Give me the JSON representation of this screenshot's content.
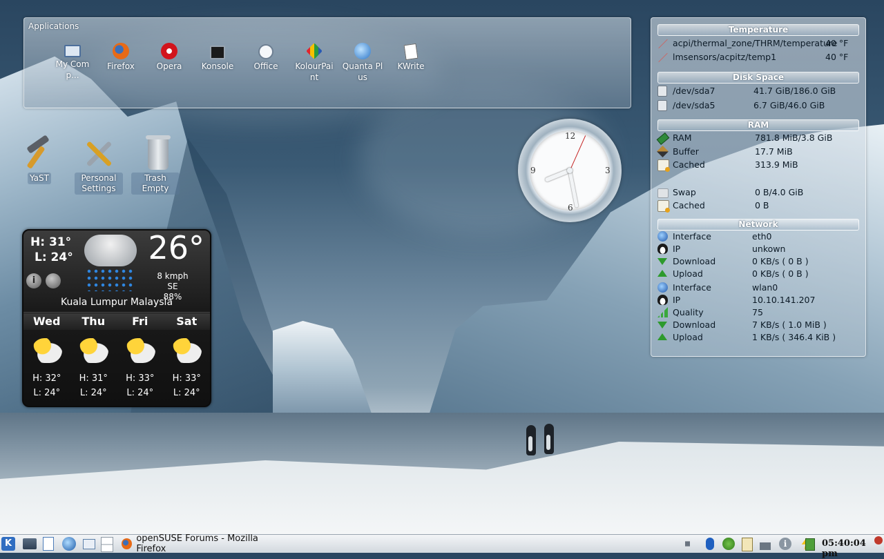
{
  "applications_panel": {
    "title": "Applications",
    "items": [
      {
        "label": "My Comp...",
        "icon": "computer-icon"
      },
      {
        "label": "Firefox",
        "icon": "firefox-icon"
      },
      {
        "label": "Opera",
        "icon": "opera-icon"
      },
      {
        "label": "Konsole",
        "icon": "terminal-icon"
      },
      {
        "label": "Office",
        "icon": "office-icon"
      },
      {
        "label": "KolourPaint",
        "icon": "paint-icon"
      },
      {
        "label": "Quanta Plus",
        "icon": "quanta-icon"
      },
      {
        "label": "KWrite",
        "icon": "editor-icon"
      }
    ]
  },
  "desktop_icons": [
    {
      "label": "YaST",
      "icon": "hammer-icon"
    },
    {
      "label": "Personal Settings",
      "icon": "tools-icon"
    },
    {
      "label": "Trash Empty",
      "icon": "trash-icon"
    }
  ],
  "weather": {
    "high": "H: 31°",
    "low": "L: 24°",
    "temperature": "26°",
    "wind": "8 kmph SE",
    "humidity": "88%",
    "location": "Kuala Lumpur Malaysia",
    "info_button": "i",
    "forecast": [
      {
        "day": "Wed",
        "high": "H: 32°",
        "low": "L: 24°"
      },
      {
        "day": "Thu",
        "high": "H: 31°",
        "low": "L: 24°"
      },
      {
        "day": "Fri",
        "high": "H: 33°",
        "low": "L: 24°"
      },
      {
        "day": "Sat",
        "high": "H: 33°",
        "low": "L: 24°"
      }
    ]
  },
  "clock": {
    "numerals": {
      "twelve": "12",
      "three": "3",
      "six": "6",
      "nine": "9"
    }
  },
  "system_monitor": {
    "temperature": {
      "header": "Temperature",
      "rows": [
        {
          "label": "acpi/thermal_zone/THRM/temperature",
          "value": "40 °F"
        },
        {
          "label": "lmsensors/acpitz/temp1",
          "value": "40 °F"
        }
      ]
    },
    "disk": {
      "header": "Disk Space",
      "rows": [
        {
          "label": "/dev/sda7",
          "value": "41.7 GiB/186.0 GiB"
        },
        {
          "label": "/dev/sda5",
          "value": "6.7 GiB/46.0 GiB"
        }
      ]
    },
    "ram": {
      "header": "RAM",
      "rows": [
        {
          "label": "RAM",
          "value": "781.8 MiB/3.8 GiB"
        },
        {
          "label": "Buffer",
          "value": "17.7 MiB"
        },
        {
          "label": "Cached",
          "value": "313.9 MiB"
        },
        {
          "label": "Swap",
          "value": "0 B/4.0 GiB"
        },
        {
          "label": "Cached",
          "value": "0 B"
        }
      ]
    },
    "network": {
      "header": "Network",
      "rows": [
        {
          "label": "Interface",
          "value": "eth0"
        },
        {
          "label": "IP",
          "value": "unkown"
        },
        {
          "label": "Download",
          "value": "0 KB/s ( 0 B )"
        },
        {
          "label": "Upload",
          "value": "0 KB/s ( 0 B )"
        },
        {
          "label": "Interface",
          "value": "wlan0"
        },
        {
          "label": "IP",
          "value": "10.10.141.207"
        },
        {
          "label": "Quality",
          "value": "75"
        },
        {
          "label": "Download",
          "value": "7 KB/s ( 1.0 MiB )"
        },
        {
          "label": "Upload",
          "value": "1 KB/s ( 346.4 KiB )"
        }
      ]
    }
  },
  "taskbar": {
    "kmenu_label": "K",
    "task_title": "openSUSE Forums - Mozilla Firefox",
    "time": "05:40:04 pm",
    "tray_info": "i"
  }
}
